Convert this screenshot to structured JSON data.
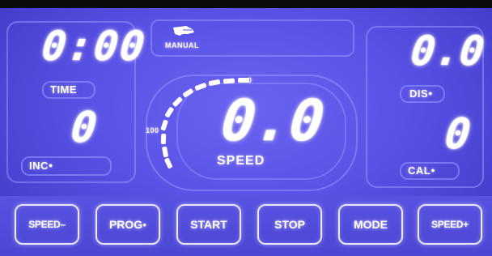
{
  "display": {
    "time": {
      "value": "0:00",
      "label": "TIME"
    },
    "incline": {
      "value": "0",
      "label": "INC"
    },
    "program": {
      "label": "MANUAL"
    },
    "speed": {
      "value": "0.0",
      "label": "SPEED",
      "gauge_min": "0",
      "gauge_max": "100"
    },
    "distance": {
      "value": "0.0",
      "label": "DIS"
    },
    "calories": {
      "value": "0",
      "label": "CAL"
    }
  },
  "buttons": {
    "speed_down": "SPEED–",
    "prog": "PROG",
    "start": "START",
    "stop": "STOP",
    "mode": "MODE",
    "speed_up": "SPEED+"
  },
  "colors": {
    "screen": "#5a52e6",
    "segment": "#ffffff",
    "outline": "#9696ff"
  },
  "icons": {
    "program": "hand-pointer-icon",
    "label_marker": "dot-icon"
  }
}
